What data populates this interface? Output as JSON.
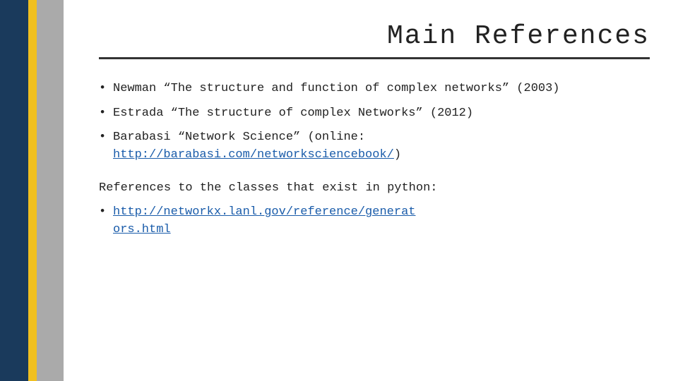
{
  "slide": {
    "title": "Main References",
    "bullets": [
      {
        "text": "Newman “The structure and function of complex networks” (2003)"
      },
      {
        "text": "Estrada “The structure of complex Networks” (2012)"
      },
      {
        "text": "Barabasi “Network Science” (online: ",
        "link": "http://barabasi.com/networksciencebook/",
        "link_suffix": ")"
      }
    ],
    "references_para": "References to the classes that exist in python:",
    "ref_links": [
      {
        "link": "http://networkx.lanl.gov/reference/generat",
        "suffix": "ors.html"
      }
    ]
  },
  "decorative": {
    "underline": true
  }
}
